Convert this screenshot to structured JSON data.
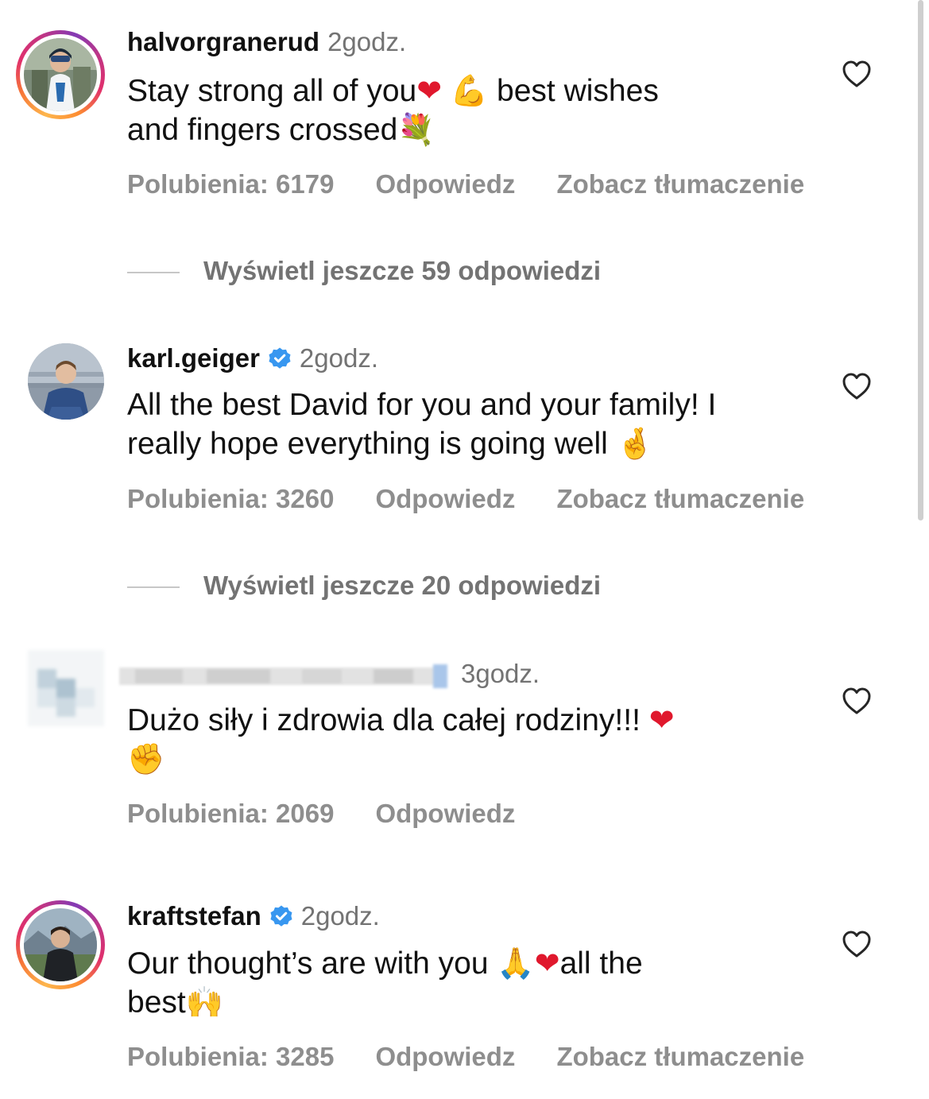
{
  "comments": [
    {
      "username": "halvorgranerud",
      "time": "2godz.",
      "verified": false,
      "text_line1": "Stay strong all of you",
      "text_line1_after": " best wishes",
      "text_line2": "and fingers crossed",
      "likes": "Polubienia: 6179",
      "reply": "Odpowiedz",
      "translate": "Zobacz tłumaczenie"
    },
    {
      "username": "karl.geiger",
      "time": "2godz.",
      "verified": true,
      "text_line1": "All the best David for you and your family! I",
      "text_line2": "really hope everything is going well",
      "likes": "Polubienia: 3260",
      "reply": "Odpowiedz",
      "translate": "Zobacz tłumaczenie"
    },
    {
      "username": "",
      "time": "3godz.",
      "verified": false,
      "text_line1": "Dużo siły i zdrowia dla całej rodziny!!!",
      "likes": "Polubienia: 2069",
      "reply": "Odpowiedz"
    },
    {
      "username": "kraftstefan",
      "time": "2godz.",
      "verified": true,
      "text_line1": "Our thought’s are with you",
      "text_line1_after": "all the",
      "text_line2": "best",
      "likes": "Polubienia: 3285",
      "reply": "Odpowiedz",
      "translate": "Zobacz tłumaczenie"
    }
  ],
  "replies_links": [
    "Wyświetl jeszcze 59 odpowiedzi",
    "Wyświetl jeszcze 20 odpowiedzi"
  ],
  "colors": {
    "verified_blue": "#3897f0",
    "muted_text": "#8e8e8e",
    "heart_red": "#e0182d"
  },
  "emoji": {
    "heart": "❤",
    "bicep": "💪",
    "bouquet": "💐",
    "crossed_fingers": "🤞",
    "fist": "✊",
    "pray": "🙏",
    "raised_hands": "🙌"
  }
}
